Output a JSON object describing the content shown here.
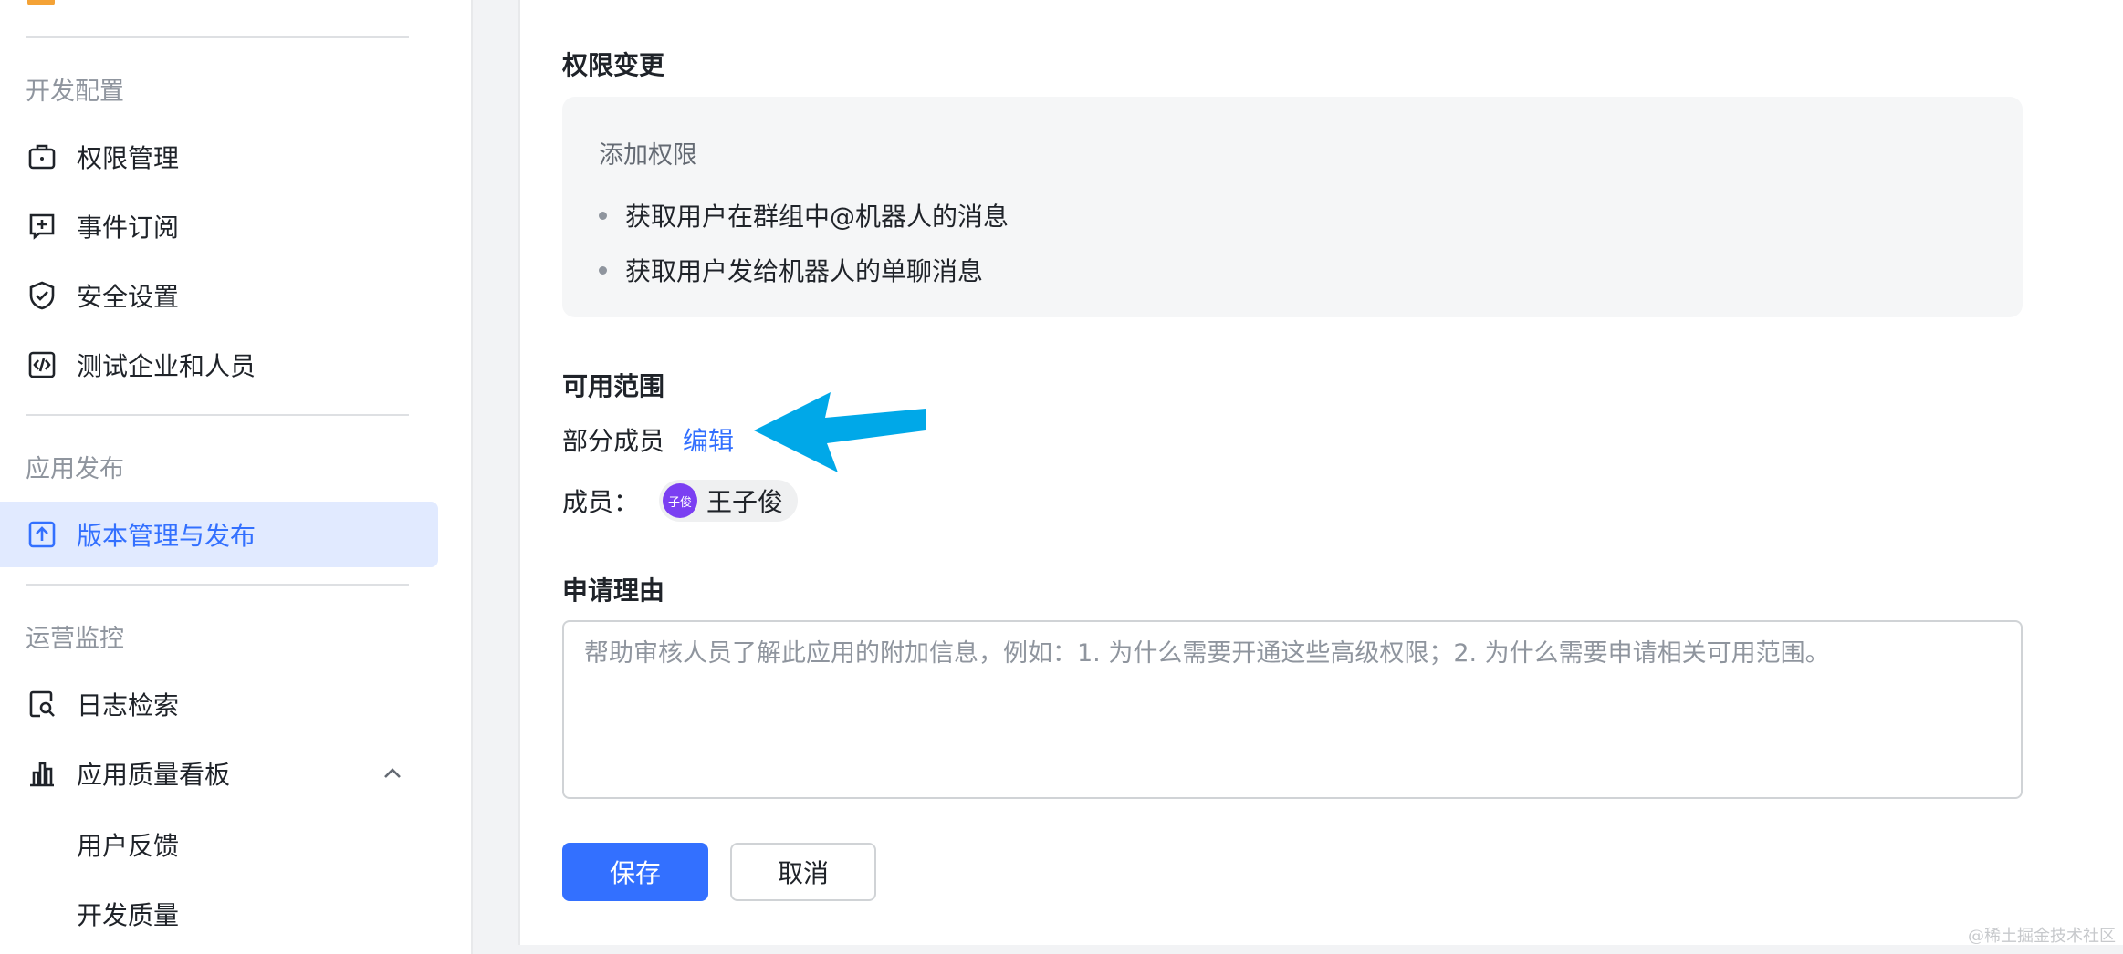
{
  "sidebar": {
    "sections": [
      {
        "title": "开发配置"
      },
      {
        "title": "应用发布"
      },
      {
        "title": "运营监控"
      }
    ],
    "items": [
      {
        "label": "权限管理",
        "icon": "briefcase-icon"
      },
      {
        "label": "事件订阅",
        "icon": "event-subscribe-icon"
      },
      {
        "label": "安全设置",
        "icon": "shield-check-icon"
      },
      {
        "label": "测试企业和人员",
        "icon": "code-box-icon"
      },
      {
        "label": "版本管理与发布",
        "icon": "upload-box-icon",
        "active": true
      },
      {
        "label": "日志检索",
        "icon": "log-search-icon"
      },
      {
        "label": "应用质量看板",
        "icon": "bar-chart-icon",
        "expanded": true
      }
    ],
    "sub_items": [
      {
        "label": "用户反馈"
      },
      {
        "label": "开发质量"
      }
    ]
  },
  "main": {
    "permission_change": {
      "title": "权限变更",
      "subtitle": "添加权限",
      "items": [
        "获取用户在群组中@机器人的消息",
        "获取用户发给机器人的单聊消息"
      ]
    },
    "scope": {
      "title": "可用范围",
      "value": "部分成员",
      "edit_label": "编辑",
      "members_label": "成员：",
      "members": [
        {
          "name": "王子俊",
          "avatar_text": "子俊"
        }
      ]
    },
    "reason": {
      "title": "申请理由",
      "value": "",
      "placeholder": "帮助审核人员了解此应用的附加信息，例如：1. 为什么需要开通这些高级权限；2. 为什么需要申请相关可用范围。"
    },
    "actions": {
      "save_label": "保存",
      "cancel_label": "取消"
    }
  },
  "watermark": "@稀土掘金技术社区",
  "colors": {
    "primary": "#3370ff",
    "active_bg": "#e1eaff",
    "annotation_arrow": "#00a8e8",
    "avatar": "#7b3ff2"
  }
}
